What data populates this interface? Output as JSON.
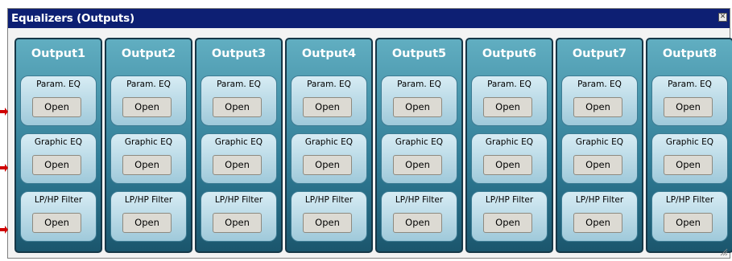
{
  "window": {
    "title": "Equalizers (Outputs)",
    "close_glyph": "✕"
  },
  "sections": [
    "Param. EQ",
    "Graphic EQ",
    "LP/HP Filter"
  ],
  "button_label": "Open",
  "outputs": [
    {
      "name": "Output1"
    },
    {
      "name": "Output2"
    },
    {
      "name": "Output3"
    },
    {
      "name": "Output4"
    },
    {
      "name": "Output5"
    },
    {
      "name": "Output6"
    },
    {
      "name": "Output7"
    },
    {
      "name": "Output8"
    }
  ],
  "colors": {
    "titlebar": "#0d1f73",
    "column_dark": "#163747",
    "arrow": "#d00000"
  }
}
